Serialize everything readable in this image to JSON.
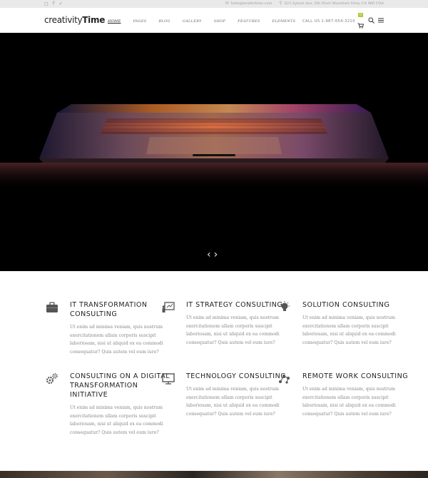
{
  "topbar": {
    "social": [
      {
        "icon": "instagram-icon",
        "glyph": "◻"
      },
      {
        "icon": "facebook-icon",
        "glyph": "f"
      },
      {
        "icon": "twitter-icon",
        "glyph": "✓"
      }
    ],
    "email": "hello@tendertime.com",
    "address": "523 Sylvan Ave, 5th Floor Mountain View, CA 960 USA"
  },
  "header": {
    "logo_thin": "creativity",
    "logo_bold": "Time",
    "nav": [
      "HOME",
      "PAGES",
      "BLOG",
      "GALLERY",
      "SHOP",
      "FEATURES",
      "ELEMENTS"
    ],
    "active_nav": "HOME",
    "call_us": "CALL US 1-987-654-3210",
    "cart_count": "0",
    "accent_color": "#b8c43c"
  },
  "hero": {
    "prev_glyph": "‹",
    "next_glyph": "›"
  },
  "services": [
    {
      "icon": "briefcase-icon",
      "title": "IT TRANSFORMATION CONSULTING",
      "text": "Ut enim ad minima veniam, quis nostrum exercitationem ullam corporis suscipit laboriosam, nisi ut aliquid ex ea commodi consequatur? Quis autem vel eum iure?"
    },
    {
      "icon": "presentation-icon",
      "title": "IT STRATEGY CONSULTING",
      "text": "Ut enim ad minima veniam, quis nostrum exercitationem ullam corporis suscipit laboriosam, nisi ut aliquid ex ea commodi consequatur? Quis autem vel eum iure?"
    },
    {
      "icon": "lightbulb-icon",
      "title": "SOLUTION CONSULTING",
      "text": "Ut enim ad minima veniam, quis nostrum exercitationem ullam corporis suscipit laboriosam, nisi ut aliquid ex ea commodi consequatur? Quis autem vel eum iure?"
    },
    {
      "icon": "gears-icon",
      "title": "CONSULTING ON A DIGITAL TRANSFORMATION INITIATIVE",
      "text": "Ut enim ad minima veniam, quis nostrum exercitationem ullam corporis suscipit laboriosam, nisi ut aliquid ex ea commodi consequatur? Quis autem vel eum iure?"
    },
    {
      "icon": "monitor-icon",
      "title": "TECHNOLOGY CONSULTING",
      "text": "Ut enim ad minima veniam, quis nostrum exercitationem ullam corporis suscipit laboriosam, nisi ut aliquid ex ea commodi consequatur? Quis autem vel eum iure?"
    },
    {
      "icon": "network-icon",
      "title": "REMOTE WORK CONSULTING",
      "text": "Ut enim ad minima veniam, quis nostrum exercitationem ullam corporis suscipit laboriosam, nisi ut aliquid ex ea commodi consequatur? Quis autem vel eum iure?"
    }
  ]
}
